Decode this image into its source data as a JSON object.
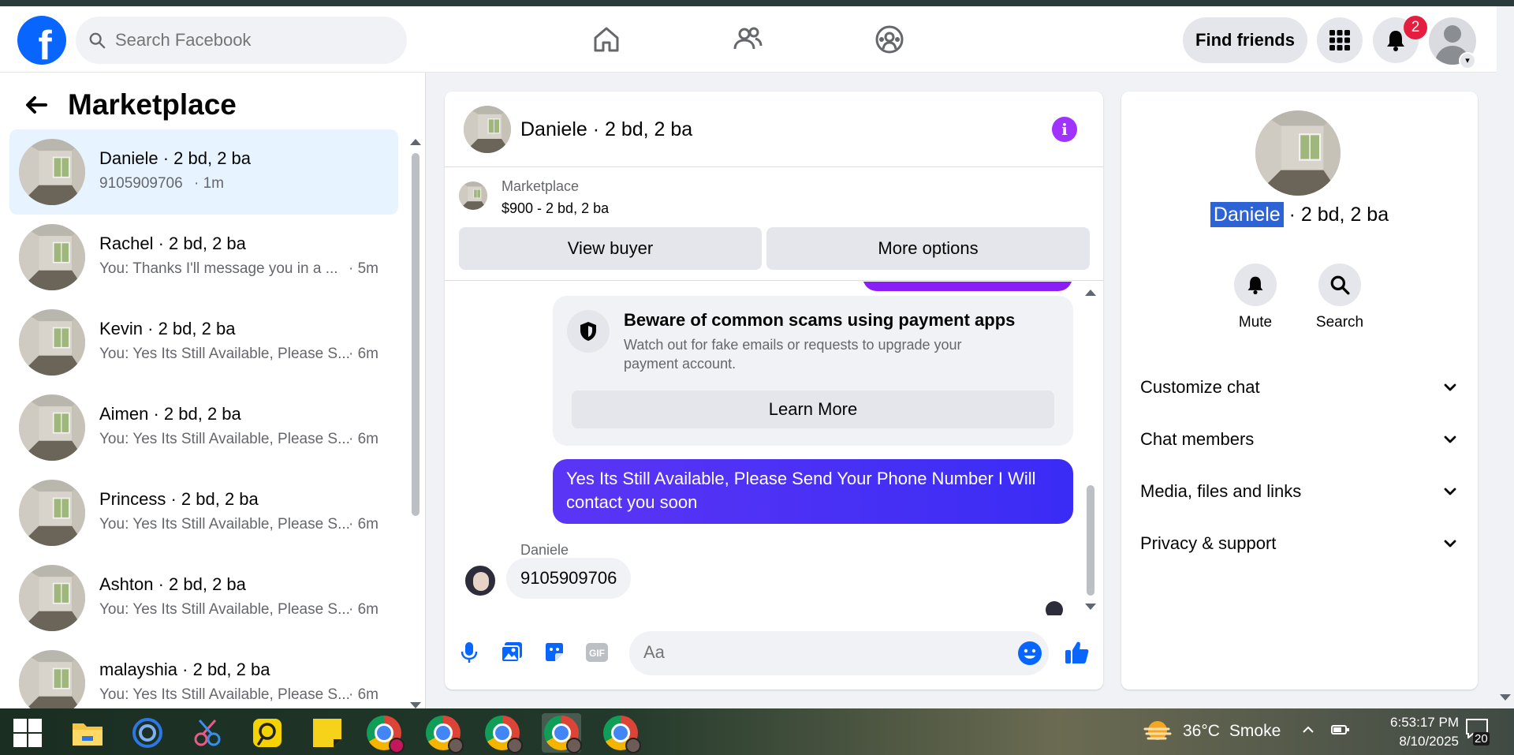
{
  "nav": {
    "logo": "f",
    "search_placeholder": "Search Facebook",
    "find_friends": "Find friends",
    "notification_count": "2"
  },
  "marketplace": {
    "title": "Marketplace",
    "conversations": [
      {
        "name": "Daniele · 2 bd, 2 ba",
        "preview": "9105909706",
        "time": "· 1m",
        "active": true
      },
      {
        "name": "Rachel · 2 bd, 2 ba",
        "preview": "You: Thanks I'll message you in a ...",
        "time": "· 5m"
      },
      {
        "name": "Kevin · 2 bd, 2 ba",
        "preview": "You: Yes Its Still Available, Please S...",
        "time": "· 6m"
      },
      {
        "name": "Aimen · 2 bd, 2 ba",
        "preview": "You: Yes Its Still Available, Please S...",
        "time": "· 6m"
      },
      {
        "name": "Princess · 2 bd, 2 ba",
        "preview": "You: Yes Its Still Available, Please S...",
        "time": "· 6m"
      },
      {
        "name": "Ashton · 2 bd, 2 ba",
        "preview": "You: Yes Its Still Available, Please S...",
        "time": "· 6m"
      },
      {
        "name": "malayshia · 2 bd, 2 ba",
        "preview": "You: Yes Its Still Available, Please S...",
        "time": "· 6m"
      }
    ]
  },
  "chat": {
    "title": "Daniele · 2 bd, 2 ba",
    "listing_source": "Marketplace",
    "listing_price": "$900 - 2 bd, 2 ba",
    "view_buyer": "View buyer",
    "more_options": "More options",
    "warning_title": "Beware of common scams using payment apps",
    "warning_text": "Watch out for fake emails or requests to upgrade your payment account.",
    "learn_more": "Learn More",
    "outgoing_message": "Yes Its Still Available, Please Send Your Phone Number I Will contact you soon",
    "incoming_sender": "Daniele",
    "incoming_message": "9105909706",
    "composer_placeholder": "Aa"
  },
  "info_panel": {
    "title_highlight": "Daniele",
    "title_rest": " · 2 bd, 2 ba",
    "mute": "Mute",
    "search": "Search",
    "sections": [
      "Customize chat",
      "Chat members",
      "Media, files and links",
      "Privacy & support"
    ]
  },
  "taskbar": {
    "temperature": "36°C",
    "condition": "Smoke",
    "time": "6:53:17 PM",
    "date": "8/10/2025",
    "notification_count": "20"
  },
  "colors": {
    "fb_blue": "#0866ff",
    "messenger_purple": "#a033ff",
    "outgoing_bubble": "#4b31f5",
    "badge_red": "#e41e3f"
  }
}
